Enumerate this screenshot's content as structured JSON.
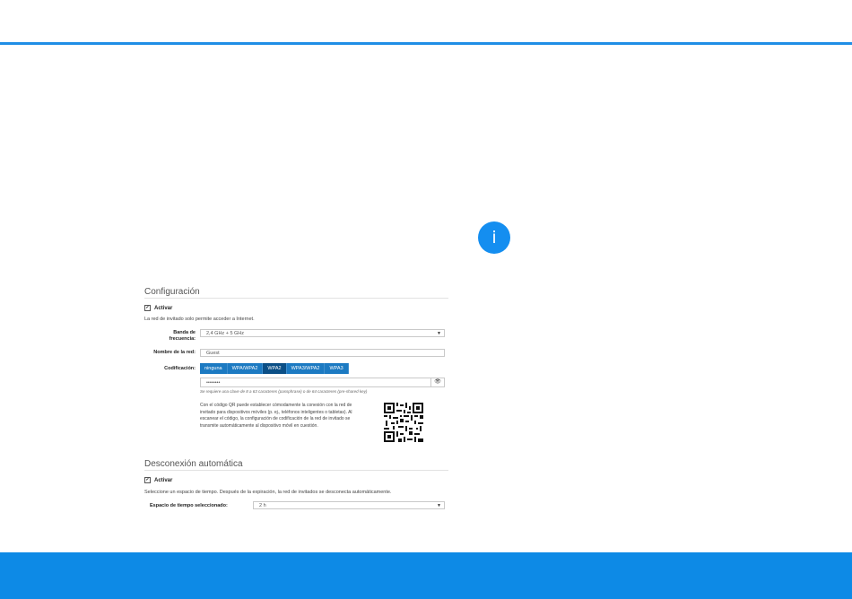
{
  "info_icon_glyph": "i",
  "config": {
    "title": "Configuración",
    "activate_label": "Activar",
    "guest_note": "La red de invitado solo permite acceder a Internet.",
    "band_label_line1": "Banda de",
    "band_label_line2": "frecuencia:",
    "band_value": "2,4 GHz + 5 GHz",
    "network_name_label": "Nombre de la red:",
    "network_name_value": "Guest",
    "encoding_label": "Codificación:",
    "encoding_options": [
      "ninguna",
      "WPA/WPA2",
      "WPA2",
      "WPA3/WPA2",
      "WPA3"
    ],
    "encoding_selected": "WPA2",
    "password_value": "••••••••",
    "password_hint": "Se requiere una clave de 8 a 63 caracteres (passphrase) o de 64 caracteres (pre-shared key)",
    "qr_text": "Con el código QR puede establecer cómodamente la conexión con la red de invitado para dispositivos móviles (p. ej., teléfonos inteligentes o tabletas). Al escanear el código, la configuración de codificación de la red de invitado se transmite automáticamente al dispositivo móvil en cuestión."
  },
  "disconnect": {
    "title": "Desconexión automática",
    "activate_label": "Activar",
    "note": "Seleccione un espacio de tiempo. Después de la expiración, la red de invitados se desconecta automáticamente.",
    "time_label": "Espacio de tiempo seleccionado:",
    "time_value": "2 h"
  },
  "colors": {
    "accent": "#1f8ee6",
    "footer": "#0d8ae6",
    "segment": "#1c7ac2",
    "segment_active": "#0b4f86"
  }
}
